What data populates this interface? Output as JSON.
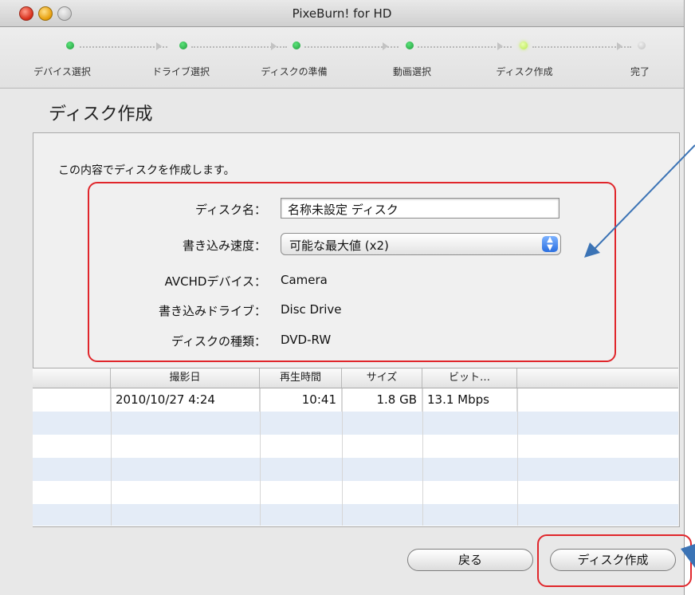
{
  "window": {
    "title": "PixeBurn! for HD"
  },
  "steps": [
    {
      "label": "デバイス選択",
      "state": "done"
    },
    {
      "label": "ドライブ選択",
      "state": "done"
    },
    {
      "label": "ディスクの準備",
      "state": "done"
    },
    {
      "label": "動画選択",
      "state": "done"
    },
    {
      "label": "ディスク作成",
      "state": "current"
    },
    {
      "label": "完了",
      "state": "pending"
    }
  ],
  "page": {
    "title": "ディスク作成",
    "intro": "この内容でディスクを作成します。"
  },
  "form": {
    "disc_name_label": "ディスク名：",
    "disc_name_value": "名称未設定 ディスク",
    "speed_label": "書き込み速度：",
    "speed_value": "可能な最大値 (x2)",
    "device_label": "AVCHDデバイス：",
    "device_value": "Camera",
    "drive_label": "書き込みドライブ：",
    "drive_value": "Disc Drive",
    "disc_type_label": "ディスクの種類：",
    "disc_type_value": "DVD-RW"
  },
  "table": {
    "headers": [
      "",
      "撮影日",
      "再生時間",
      "サイズ",
      "ビット…",
      ""
    ],
    "rows": [
      [
        "",
        "2010/10/27  4:24",
        "10:41",
        "1.8 GB",
        "13.1 Mbps",
        ""
      ]
    ]
  },
  "buttons": {
    "back_label": "戻る",
    "create_label": "ディスク作成"
  },
  "colors": {
    "annotation_red": "#e0262b",
    "annotation_blue": "#3b73b5",
    "stripe": "#e4ecf7"
  }
}
